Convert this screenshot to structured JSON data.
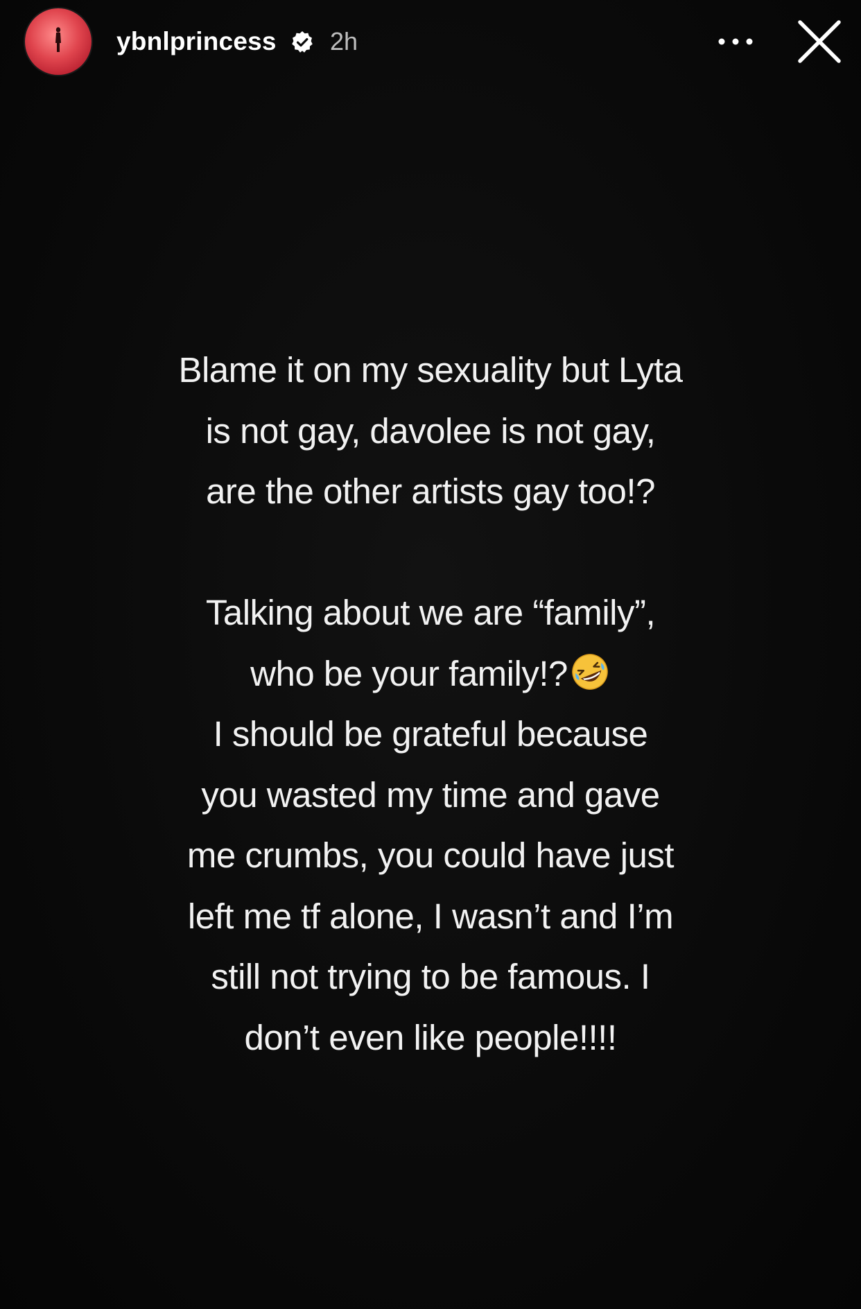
{
  "header": {
    "username": "ybnlprincess",
    "verified_icon": "verified-badge-icon",
    "timestamp": "2h",
    "more_icon": "more-options-icon",
    "close_icon": "close-icon",
    "avatar_icon": "profile-avatar",
    "avatar_color": "#e0454e"
  },
  "story": {
    "background_color": "#0a0a0a",
    "text_color": "#f2f2f2",
    "lines": [
      "Blame it on my sexuality but Lyta",
      "is not gay, davolee is not gay,",
      "are the other artists gay too!?",
      "",
      "Talking about we are “family”,",
      "who be your family!?",
      "I should be grateful because",
      "you wasted my time and gave",
      "me crumbs, you could have just",
      "left me tf alone, I wasn’t and I’m",
      "still not trying to be famous. I",
      "don’t even like people!!!!"
    ],
    "emoji_icon": "rolling-on-floor-laughing-emoji"
  }
}
